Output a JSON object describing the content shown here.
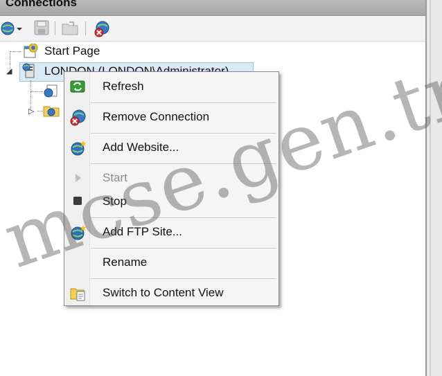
{
  "panel": {
    "title": "Connections"
  },
  "toolbar": {
    "buttons": [
      {
        "icon": "globe-connect-icon"
      },
      {
        "icon": "save-icon"
      },
      {
        "icon": "open-folder-icon"
      },
      {
        "icon": "disconnect-icon"
      }
    ]
  },
  "tree": {
    "items": [
      {
        "label": "Start Page",
        "icon": "start-page-icon"
      },
      {
        "label": "LONDON (LONDON\\Administrator)",
        "icon": "server-icon",
        "selected": true,
        "expanded": true
      }
    ]
  },
  "context_menu": {
    "items": [
      {
        "label": "Refresh",
        "icon": "refresh-icon",
        "enabled": true
      },
      {
        "label": "Remove Connection",
        "icon": "remove-connection-icon",
        "enabled": true
      },
      {
        "label": "Add Website...",
        "icon": "add-website-icon",
        "enabled": true
      },
      {
        "label": "Start",
        "icon": "start-icon",
        "enabled": false
      },
      {
        "label": "Stop",
        "icon": "stop-icon",
        "enabled": true
      },
      {
        "label": "Add FTP Site...",
        "icon": "add-ftp-site-icon",
        "enabled": true
      },
      {
        "label": "Rename",
        "icon": "",
        "enabled": true
      },
      {
        "label": "Switch to Content View",
        "icon": "content-view-icon",
        "enabled": true
      }
    ]
  },
  "watermark": {
    "text": "mcse.gen.tr"
  },
  "colors": {
    "header_bg": "#a6a6a6",
    "selection_bg": "#dbe9f7",
    "menu_bg": "#f5f5f5",
    "refresh_green": "#3a9a3a"
  }
}
